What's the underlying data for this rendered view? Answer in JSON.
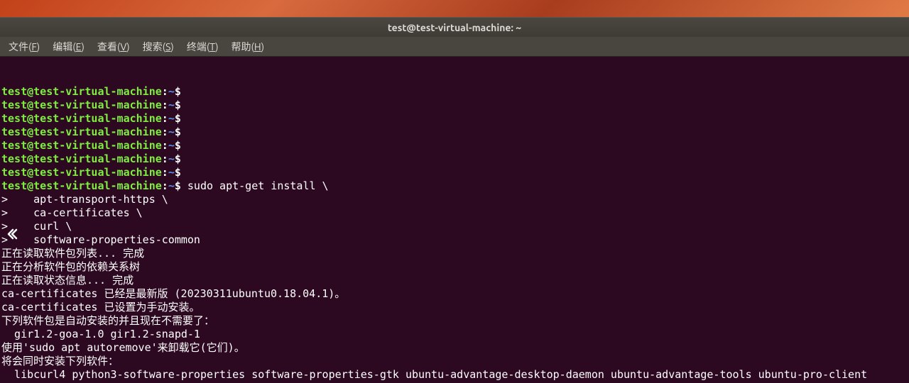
{
  "desktop": {},
  "window": {
    "title": "test@test-virtual-machine: ~"
  },
  "menu": {
    "items": [
      {
        "label": "文件",
        "key": "F"
      },
      {
        "label": "编辑",
        "key": "E"
      },
      {
        "label": "查看",
        "key": "V"
      },
      {
        "label": "搜索",
        "key": "S"
      },
      {
        "label": "终端",
        "key": "T"
      },
      {
        "label": "帮助",
        "key": "H"
      }
    ]
  },
  "terminal": {
    "prompt_user": "test@test-virtual-machine",
    "prompt_path": "~",
    "prompt_sep": ":",
    "prompt_end": "$",
    "empty_prompts": 7,
    "command_first": "sudo apt-get install \\",
    "command_continuations": [
      ">    apt-transport-https \\",
      ">    ca-certificates \\",
      ">    curl \\",
      ">    software-properties-common"
    ],
    "output_lines": [
      "正在读取软件包列表... 完成",
      "正在分析软件包的依赖关系树",
      "正在读取状态信息... 完成",
      "ca-certificates 已经是最新版 (20230311ubuntu0.18.04.1)。",
      "ca-certificates 已设置为手动安装。",
      "下列软件包是自动安装的并且现在不需要了：",
      "  gir1.2-goa-1.0 gir1.2-snapd-1",
      "使用'sudo apt autoremove'来卸载它(它们)。",
      "将会同时安装下列软件：",
      "  libcurl4 python3-software-properties software-properties-gtk ubuntu-advantage-desktop-daemon ubuntu-advantage-tools ubuntu-pro-client"
    ]
  }
}
